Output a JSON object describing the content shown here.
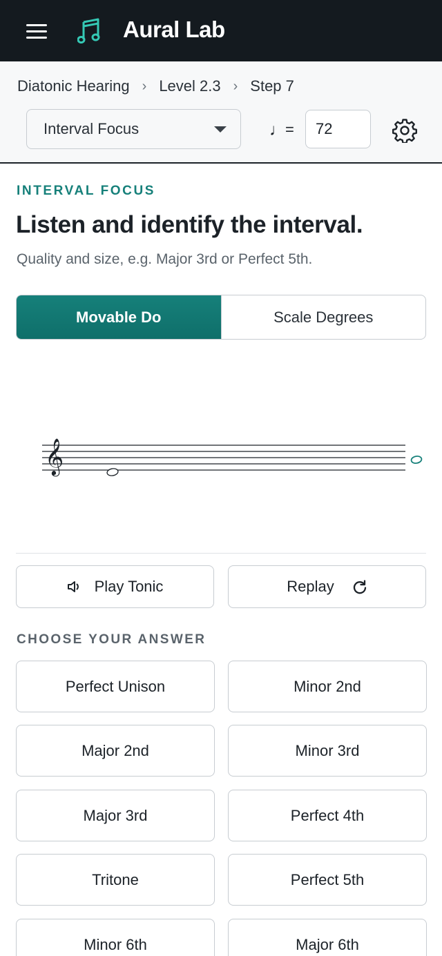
{
  "app": {
    "title": "Aural Lab",
    "brand_color": "#141a1f",
    "accent_color": "#16807a"
  },
  "icons": {
    "menu": "hamburger-menu-icon",
    "logo": "music-note-icon",
    "settings": "gear-icon",
    "speaker": "speaker-icon",
    "replay": "refresh-icon",
    "dropdown": "caret-down-icon"
  },
  "breadcrumb": {
    "items": [
      "Diatonic Hearing",
      "Level 2.3",
      "Step 7"
    ],
    "separator": "›"
  },
  "mode_select": {
    "value": "Interval Focus"
  },
  "tempo": {
    "note_symbol": "♩",
    "equals": "=",
    "value": "72"
  },
  "exercise": {
    "eyebrow": "INTERVAL FOCUS",
    "headline": "Listen and identify the interval.",
    "subhead": "Quality and size, e.g. Major 3rd or Perfect 5th."
  },
  "solfege_toggle": {
    "options": [
      "Movable Do",
      "Scale Degrees"
    ],
    "selected": "Movable Do"
  },
  "staff": {
    "clef": "treble",
    "clef_glyph": "𝄞"
  },
  "actions": {
    "play_tonic": "Play Tonic",
    "replay": "Replay"
  },
  "answers": {
    "label": "CHOOSE YOUR ANSWER",
    "options": [
      "Perfect Unison",
      "Minor 2nd",
      "Major 2nd",
      "Minor 3rd",
      "Major 3rd",
      "Perfect 4th",
      "Tritone",
      "Perfect 5th",
      "Minor 6th",
      "Major 6th"
    ]
  }
}
